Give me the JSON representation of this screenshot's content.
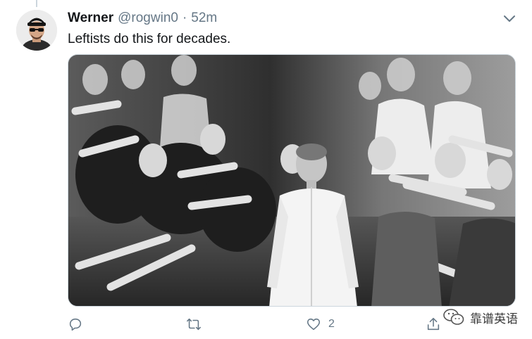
{
  "tweet": {
    "display_name": "Werner",
    "handle": "@rogwin0",
    "separator": "·",
    "timestamp": "52m",
    "text": "Leftists do this for decades."
  },
  "icons": {
    "avatar": "avatar-photo",
    "caret": "chevron-down-icon",
    "reply": "reply-icon",
    "retweet": "retweet-icon",
    "like": "heart-icon",
    "share": "share-icon",
    "watermark": "wechat-logo-icon"
  },
  "actions": {
    "reply_count": "",
    "retweet_count": "",
    "like_count": "2"
  },
  "watermark": {
    "text": "靠谱英语"
  },
  "colors": {
    "text_primary": "#14171a",
    "text_secondary": "#657786",
    "border": "#ccd6dd"
  }
}
